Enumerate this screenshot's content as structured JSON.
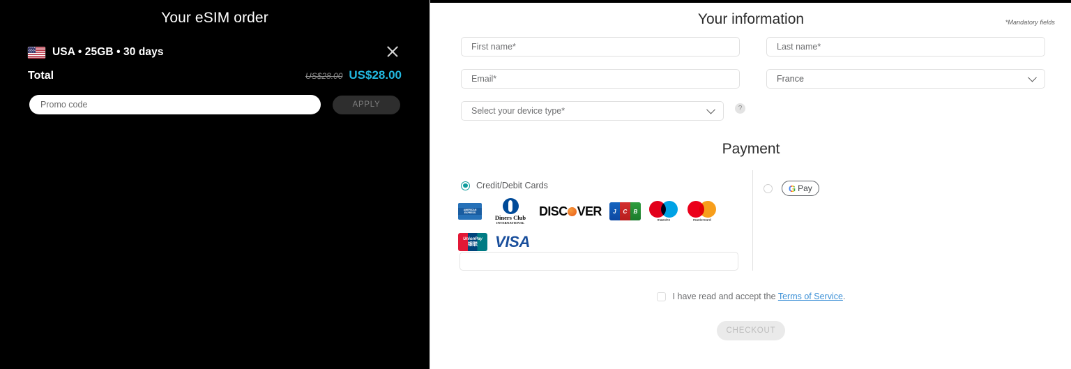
{
  "order": {
    "title": "Your eSIM order",
    "item_flag": "usa-flag-icon",
    "item_label": "USA • 25GB • 30 days",
    "close_icon": "close-icon",
    "total_label": "Total",
    "price_original": "US$28.00",
    "price_current": "US$28.00",
    "promo_placeholder": "Promo code",
    "promo_value": "",
    "apply_label": "APPLY"
  },
  "info": {
    "title": "Your information",
    "mandatory_note": "*Mandatory fields",
    "first_name_placeholder": "First name*",
    "first_name_value": "",
    "last_name_placeholder": "Last name*",
    "last_name_value": "",
    "email_placeholder": "Email*",
    "email_value": "",
    "country_selected": "France",
    "device_placeholder": "Select your device type*",
    "help_glyph": "?"
  },
  "payment": {
    "title": "Payment",
    "credit_option_label": "Credit/Debit Cards",
    "credit_selected": true,
    "card_number_value": "",
    "gpay_selected": false,
    "gpay_g": "G",
    "gpay_label": "Pay",
    "card_brands": [
      {
        "name": "american-express",
        "label": "AMERICAN EXPRESS"
      },
      {
        "name": "diners-club",
        "label_top": "Diners Club",
        "label_bottom": "INTERNATIONAL"
      },
      {
        "name": "discover",
        "label_a": "DISC",
        "label_b": "VER"
      },
      {
        "name": "jcb",
        "label": "JCB"
      },
      {
        "name": "maestro",
        "label": "maestro"
      },
      {
        "name": "mastercard",
        "label": "mastercard"
      },
      {
        "name": "unionpay",
        "label_top": "UnionPay",
        "label_bottom": "银联"
      },
      {
        "name": "visa",
        "label": "VISA"
      }
    ]
  },
  "footer": {
    "terms_text": "I have read and accept the ",
    "terms_link": "Terms of Service",
    "terms_period": ".",
    "terms_checked": false,
    "checkout_label": "CHECKOUT"
  },
  "colors": {
    "accent_price": "#22b8e0",
    "radio_on": "#0e9c9c",
    "link": "#3a8fd6",
    "panel_dark": "#000000"
  }
}
